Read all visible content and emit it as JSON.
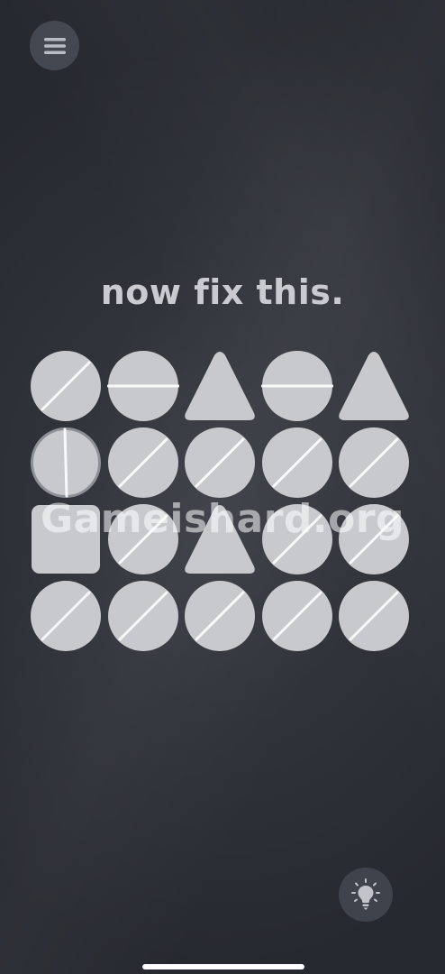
{
  "header": {
    "menu_icon": "hamburger-menu-icon"
  },
  "level": {
    "instruction": "now fix this."
  },
  "board": {
    "rows": 4,
    "cols": 5,
    "piece_color": "#c8c9cd",
    "selected_outline": "#8e9098",
    "line_color": "#ffffff",
    "tiles": [
      {
        "shape": "circle",
        "line": "diagonal"
      },
      {
        "shape": "circle",
        "line": "horizontal"
      },
      {
        "shape": "triangle",
        "line": "none"
      },
      {
        "shape": "circle",
        "line": "horizontal"
      },
      {
        "shape": "triangle",
        "line": "none"
      },
      {
        "shape": "circle",
        "line": "vertical",
        "selected": true
      },
      {
        "shape": "circle",
        "line": "diagonal"
      },
      {
        "shape": "circle",
        "line": "diagonal"
      },
      {
        "shape": "circle",
        "line": "diagonal"
      },
      {
        "shape": "circle",
        "line": "diagonal"
      },
      {
        "shape": "square",
        "line": "none"
      },
      {
        "shape": "circle",
        "line": "diagonal"
      },
      {
        "shape": "triangle",
        "line": "none"
      },
      {
        "shape": "circle",
        "line": "diagonal"
      },
      {
        "shape": "circle",
        "line": "diagonal"
      },
      {
        "shape": "circle",
        "line": "diagonal"
      },
      {
        "shape": "circle",
        "line": "diagonal"
      },
      {
        "shape": "circle",
        "line": "diagonal"
      },
      {
        "shape": "circle",
        "line": "diagonal"
      },
      {
        "shape": "circle",
        "line": "diagonal"
      }
    ]
  },
  "footer": {
    "hint_icon": "lightbulb-icon"
  },
  "watermark": {
    "text": "Gameishard.org"
  }
}
